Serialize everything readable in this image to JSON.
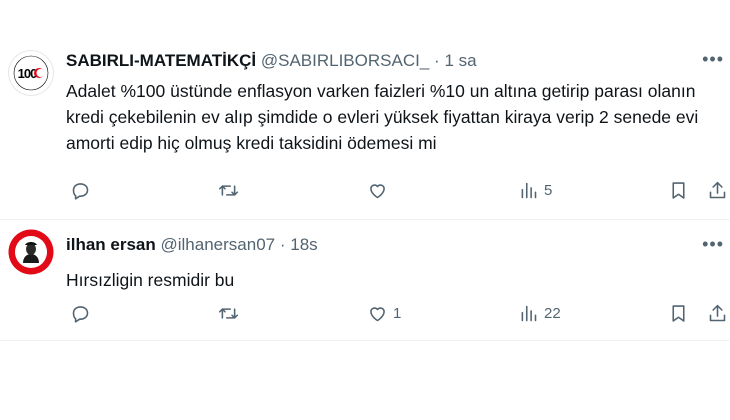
{
  "tweets": [
    {
      "display_name": "SABIRLI-MATEMATİKÇİ",
      "handle": "@SABIRLIBORSACI_",
      "separator": "·",
      "time": "1 sa",
      "text": "Adalet %100 üstünde enflasyon varken faizleri %10 un altına getirip parası olanın kredi çekebilenin ev alıp şimdide o evleri yüksek fiyattan kiraya verip 2 senede evi amorti edip hiç olmuş kredi taksidini ödemesi mi",
      "avatar_text": "100",
      "reply_count": "",
      "retweet_count": "",
      "like_count": "",
      "view_count": "5",
      "more": "•••"
    },
    {
      "display_name": "ilhan ersan",
      "handle": "@ilhanersan07",
      "separator": "·",
      "time": "18s",
      "text": "Hırsızligin resmidir bu",
      "reply_count": "",
      "retweet_count": "",
      "like_count": "1",
      "view_count": "22",
      "more": "•••"
    }
  ],
  "colors": {
    "text_primary": "#0f1419",
    "text_secondary": "#536471",
    "avatar1_bg": "#ffffff",
    "avatar1_accent": "#e30a17",
    "avatar2_bg": "#e30a17",
    "divider": "#eff3f4"
  },
  "icons": [
    "reply-icon",
    "retweet-icon",
    "like-icon",
    "views-icon",
    "bookmark-icon",
    "share-icon",
    "more-icon"
  ]
}
